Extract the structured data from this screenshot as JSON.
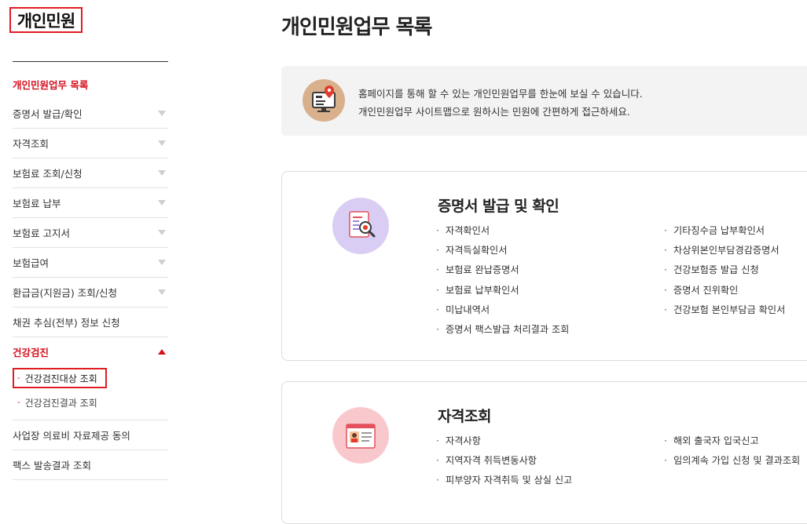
{
  "sidebar": {
    "title": "개인민원",
    "items": [
      {
        "label": "개인민원업무 목록"
      },
      {
        "label": "증명서 발급/확인"
      },
      {
        "label": "자격조회"
      },
      {
        "label": "보험료 조회/신청"
      },
      {
        "label": "보험료 납부"
      },
      {
        "label": "보험료 고지서"
      },
      {
        "label": "보험급여"
      },
      {
        "label": "환급금(지원금) 조회/신청"
      },
      {
        "label": "채권 추심(전부) 정보 신청"
      },
      {
        "label": "건강검진"
      }
    ],
    "sub_items": [
      {
        "label": "건강검진대상 조회"
      },
      {
        "label": "건강검진결과 조회"
      }
    ],
    "items_after": [
      {
        "label": "사업장 의료비 자료제공 동의"
      },
      {
        "label": "팩스 발송결과 조회"
      }
    ]
  },
  "main": {
    "title": "개인민원업무 목록",
    "info": {
      "line1": "홈페이지를 통해 할 수 있는 개인민원업무를 한눈에 보실 수 있습니다.",
      "line2": "개인민원업무 사이트맵으로 원하시는 민원에 간편하게 접근하세요."
    },
    "sections": [
      {
        "title": "증명서 발급 및 확인",
        "left": [
          "자격확인서",
          "자격득실확인서",
          "보험료 완납증명서",
          "보험료 납부확인서",
          "미납내역서",
          "증명서 팩스발급 처리결과 조회"
        ],
        "right": [
          "기타징수금 납부확인서",
          "차상위본인부담경감증명서",
          "건강보험증 발급 신청",
          "증명서 진위확인",
          "건강보험 본인부담금 확인서"
        ]
      },
      {
        "title": "자격조회",
        "left": [
          "자격사항",
          "지역자격 취득변동사항",
          "피부양자 자격취득 및 상실 신고"
        ],
        "right": [
          "해외 출국자 입국신고",
          "임의계속 가입 신청 및 결과조회"
        ]
      }
    ]
  },
  "bullet": "·",
  "dash": "-",
  "colors": {
    "accent": "#d60f1d",
    "highlight_box": "#e01b24"
  }
}
